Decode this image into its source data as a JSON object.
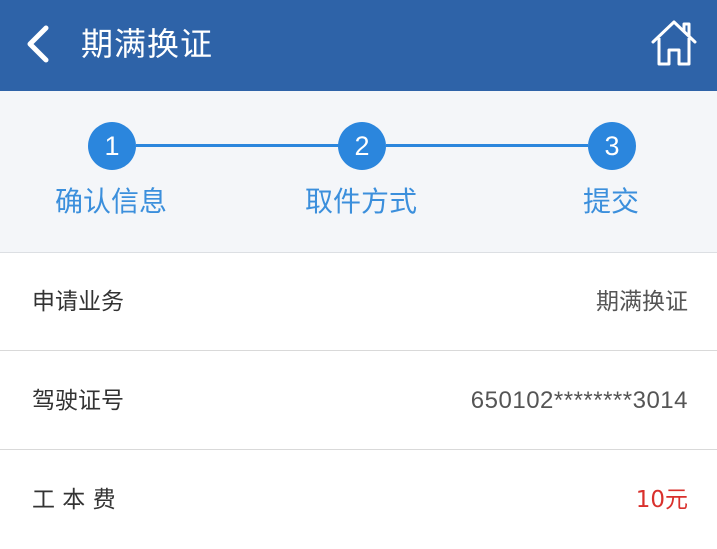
{
  "header": {
    "title": "期满换证",
    "back_icon": "chevron-left-icon",
    "home_icon": "home-icon",
    "background": "#2e63a8"
  },
  "stepper": {
    "accent": "#2b86dd",
    "steps": [
      {
        "number": "1",
        "label": "确认信息"
      },
      {
        "number": "2",
        "label": "取件方式"
      },
      {
        "number": "3",
        "label": "提交"
      }
    ]
  },
  "details": {
    "rows": [
      {
        "label": "申请业务",
        "value": "期满换证"
      },
      {
        "label": "驾驶证号",
        "value": "650102********3014"
      },
      {
        "label": "工 本 费",
        "value": "10元"
      }
    ],
    "fee_color": "#d9302c"
  }
}
